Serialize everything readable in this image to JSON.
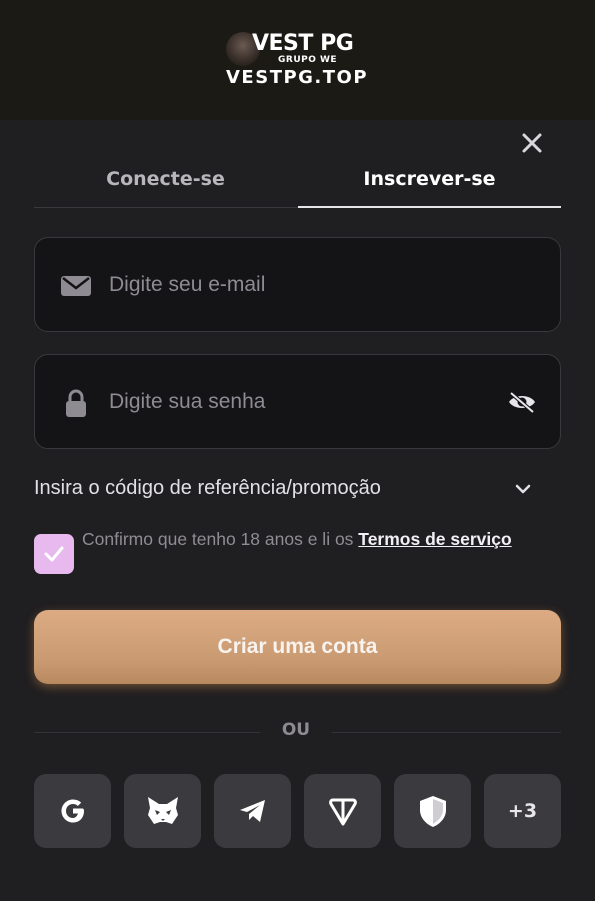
{
  "header": {
    "logo_text": "VEST PG",
    "logo_subtext": "GRUPO WE",
    "site_url": "VESTPG.TOP"
  },
  "tabs": [
    {
      "label": "Conecte-se",
      "active": false
    },
    {
      "label": "Inscrever-se",
      "active": true
    }
  ],
  "form": {
    "email_placeholder": "Digite seu e-mail",
    "email_value": "",
    "password_placeholder": "Digite sua senha",
    "password_value": "",
    "promo_label": "Insira o código de referência/promoção",
    "consent_text": "Confirmo que tenho 18 anos e li os ",
    "terms_link": "Termos de serviço",
    "consent_checked": true,
    "submit_label": "Criar uma conta"
  },
  "divider_label": "OU",
  "social": [
    {
      "name": "google",
      "icon": "google-icon"
    },
    {
      "name": "metamask",
      "icon": "fox-icon"
    },
    {
      "name": "telegram",
      "icon": "telegram-icon"
    },
    {
      "name": "ton",
      "icon": "ton-icon"
    },
    {
      "name": "shield",
      "icon": "shield-icon"
    },
    {
      "name": "more",
      "label": "+3"
    }
  ],
  "colors": {
    "background": "#1f1e20",
    "header_bg": "#1c1a15",
    "accent_button": "#d4a47c",
    "checkbox": "#e7b9ef",
    "social_button_bg": "#3b3a3e"
  }
}
